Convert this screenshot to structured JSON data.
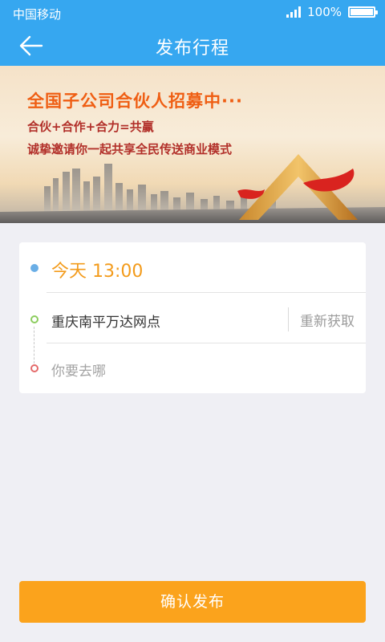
{
  "status_bar": {
    "carrier": "中国移动",
    "battery_text": "100%",
    "signal_icon": "signal-bars-icon",
    "battery_icon": "battery-full-icon"
  },
  "header": {
    "title": "发布行程",
    "back_icon": "arrow-left-icon",
    "background": "#36a7f0"
  },
  "banner": {
    "line1": "全国子公司合伙人招募中···",
    "line2": "合伙+合作+合力=共赢",
    "line3": "诚挚邀请你一起共享全民传送商业模式"
  },
  "trip_form": {
    "time_value": "今天 13:00",
    "origin_value": "重庆南平万达网点",
    "refresh_label": "重新获取",
    "destination_placeholder": "你要去哪",
    "time_color": "#f39b1b"
  },
  "actions": {
    "confirm_label": "确认发布",
    "confirm_color": "#fba31c"
  }
}
